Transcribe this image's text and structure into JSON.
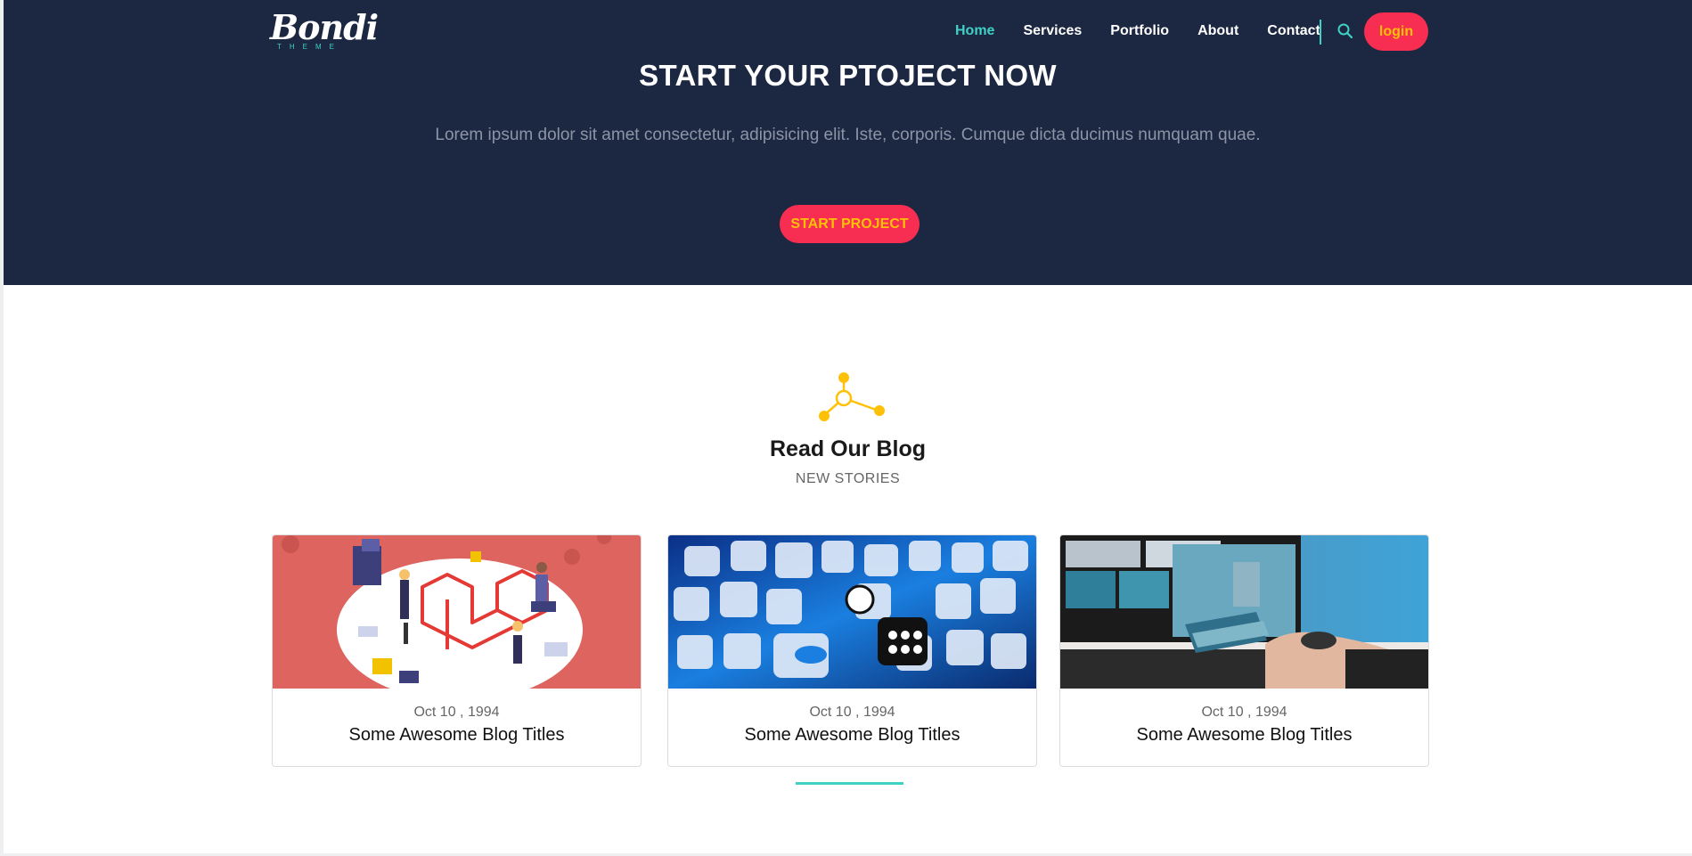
{
  "header": {
    "logo_text": "Bondi",
    "logo_subtext": "THEME",
    "nav": [
      "Home",
      "Services",
      "Portfolio",
      "About",
      "Contact"
    ],
    "active_nav": "Home",
    "login_label": "login"
  },
  "hero": {
    "title": "START YOUR PTOJECT NOW",
    "text": "Lorem ipsum dolor sit amet consectetur, adipisicing elit. Iste, corporis. Cumque dicta ducimus numquam quae.",
    "cta_label": "START PROJECT"
  },
  "blog": {
    "title": "Read Our Blog",
    "subtitle": "NEW STORIES",
    "posts": [
      {
        "date": "Oct 10 , 1994",
        "title": "Some Awesome Blog Titles"
      },
      {
        "date": "Oct 10 , 1994",
        "title": "Some Awesome Blog Titles"
      },
      {
        "date": "Oct 10 , 1994",
        "title": "Some Awesome Blog Titles"
      }
    ]
  },
  "colors": {
    "hero_bg": "#1c2741",
    "accent_teal": "#3fd1c5",
    "button_red": "#f72e51",
    "button_text": "#ffc107",
    "icon_yellow": "#ffc107"
  },
  "icons": [
    "search-icon",
    "network-icon"
  ]
}
